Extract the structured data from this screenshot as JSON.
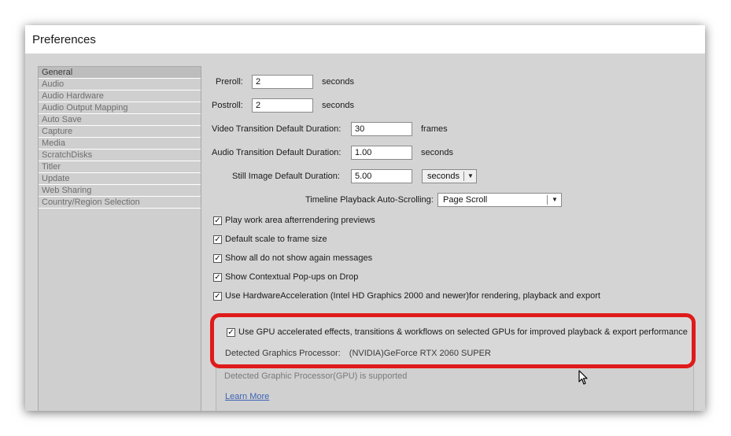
{
  "window": {
    "title": "Preferences"
  },
  "sidebar": {
    "items": [
      {
        "label": "General",
        "selected": true
      },
      {
        "label": "Audio"
      },
      {
        "label": "Audio Hardware"
      },
      {
        "label": "Audio Output Mapping"
      },
      {
        "label": "Auto Save"
      },
      {
        "label": "Capture"
      },
      {
        "label": "Media"
      },
      {
        "label": "ScratchDisks"
      },
      {
        "label": "Titler"
      },
      {
        "label": "Update"
      },
      {
        "label": "Web Sharing"
      },
      {
        "label": "Country/Region Selection"
      }
    ]
  },
  "general": {
    "preroll": {
      "label": "Preroll:",
      "value": "2",
      "unit": "seconds"
    },
    "postroll": {
      "label": "Postroll:",
      "value": "2",
      "unit": "seconds"
    },
    "video_transition": {
      "label": "Video Transition Default Duration:",
      "value": "30",
      "unit": "frames"
    },
    "audio_transition": {
      "label": "Audio Transition Default Duration:",
      "value": "1.00",
      "unit": "seconds"
    },
    "still_image": {
      "label": "Still Image Default Duration:",
      "value": "5.00",
      "unit_select": "seconds"
    },
    "timeline_scroll": {
      "label": "Timeline Playback Auto-Scrolling:",
      "value": "Page Scroll"
    },
    "checkboxes": [
      {
        "label": "Play work area afterrendering previews",
        "checked": true
      },
      {
        "label": "Default scale to frame size",
        "checked": true
      },
      {
        "label": "Show all do not show again messages",
        "checked": true
      },
      {
        "label": "Show Contextual Pop-ups on Drop",
        "checked": true
      },
      {
        "label": "Use HardwareAcceleration (Intel HD Graphics 2000 and newer)for rendering, playback and export",
        "checked": true
      }
    ]
  },
  "gpu": {
    "checkbox_label": "Use GPU accelerated effects, transitions & workflows on selected GPUs for improved playback & export performance",
    "checked": true,
    "detected_label": "Detected Graphics Processor:",
    "detected_value": "(NVIDIA)GeForce RTX 2060 SUPER",
    "support_text": "Detected Graphic Processor(GPU) is supported",
    "learn_more": "Learn More"
  },
  "colors": {
    "highlight": "#e01a1a",
    "link": "#3d63b5"
  }
}
